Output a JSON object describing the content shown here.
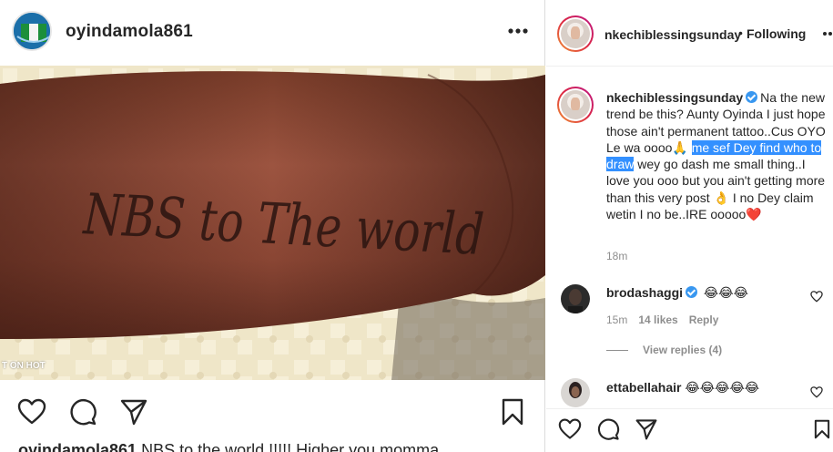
{
  "post_owner": {
    "username": "oyindamola861"
  },
  "photo": {
    "main_text": "NBS to The world",
    "watermark": "T ON HOT"
  },
  "left_caption": {
    "username": "oyindamola861",
    "text": " NBS to the world !!!!! Higher you momma"
  },
  "right_header": {
    "username": "nkechiblessingsunday",
    "dot": "•",
    "following_label": "Following"
  },
  "caption": {
    "username": "nkechiblessingsunday",
    "text_before": "Na the new trend be this? Aunty Oyinda I just hope those ain't permanent tattoo..Cus OYO Le wa oooo🙏 ",
    "text_highlighted": "me sef Dey find who to draw",
    "text_after": " wey go dash me small thing..I love you ooo but you ain't getting more than this very post 👌 I no Dey claim wetin I no be..IRE ooooo",
    "heart_emoji": "❤️",
    "time": "18m"
  },
  "comments": [
    {
      "username": "brodashaggi",
      "verified": true,
      "text": "😂😂😂",
      "time": "15m",
      "likes": "14 likes",
      "reply_label": "Reply",
      "view_replies": "View replies (4)"
    },
    {
      "username": "ettabellahair",
      "verified": false,
      "text": "😂😂😂😂😂"
    }
  ],
  "icons": {
    "like": "heart-icon",
    "comment": "comment-icon",
    "share": "paper-plane-icon",
    "save": "bookmark-icon",
    "more": "more-dots-icon",
    "verified": "verified-badge-icon"
  },
  "colors": {
    "highlight": "#3390ff",
    "verified": "#3897f0",
    "secondary_text": "#8e8e8e",
    "primary_text": "#262626"
  }
}
